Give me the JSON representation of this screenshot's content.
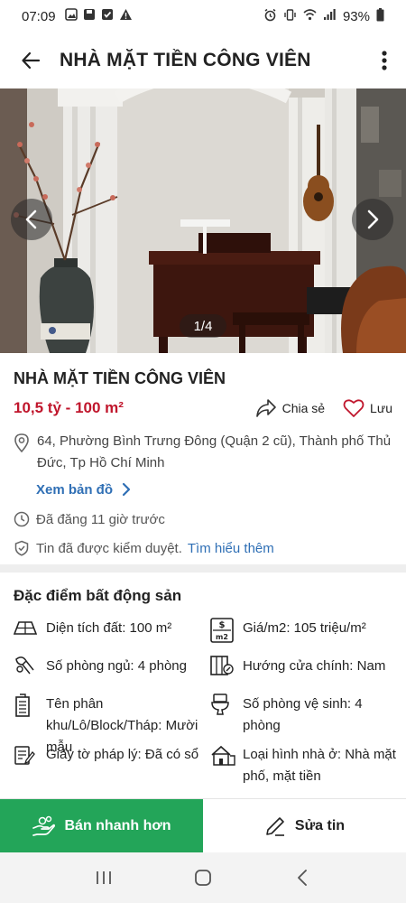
{
  "status_bar": {
    "time": "07:09",
    "battery": "93%",
    "left_icons": [
      "image-icon",
      "save-icon",
      "check-square-icon",
      "warning-icon"
    ],
    "right_icons": [
      "alarm-icon",
      "vibrate-icon",
      "wifi-icon",
      "signal-icon",
      "battery-icon"
    ]
  },
  "app_bar": {
    "title": "NHÀ MẶT TIỀN CÔNG VIÊN"
  },
  "gallery": {
    "counter": "1/4"
  },
  "listing": {
    "title": "NHÀ MẶT TIỀN CÔNG VIÊN",
    "price": "10,5 tỷ",
    "separator": "-",
    "area": "100 m²",
    "share_label": "Chia sẻ",
    "save_label": "Lưu",
    "address": "64, Phường Bình Trưng Đông (Quận 2 cũ), Thành phố Thủ Đức, Tp Hồ Chí Minh",
    "map_link": "Xem bản đồ",
    "posted": "Đã đăng 11 giờ trước",
    "moderated": "Tin đã được kiểm duyệt.",
    "learn_more": "Tìm hiểu thêm"
  },
  "features": {
    "heading": "Đặc điểm bất động sản",
    "items": [
      {
        "icon": "land-area-icon",
        "text": "Diện tích đất: 100 m²"
      },
      {
        "icon": "price-per-m2-icon",
        "text": "Giá/m2: 105 triệu/m²"
      },
      {
        "icon": "bedroom-icon",
        "text": "Số phòng ngủ: 4 phòng"
      },
      {
        "icon": "door-direction-icon",
        "text": "Hướng cửa chính: Nam"
      },
      {
        "icon": "building-block-icon",
        "text": "Tên phân khu/Lô/Block/Tháp: Mười mẫu"
      },
      {
        "icon": "toilet-icon",
        "text": "Số phòng vệ sinh: 4 phòng"
      },
      {
        "icon": "legal-document-icon",
        "text": "Giấy tờ pháp lý: Đã có sổ"
      },
      {
        "icon": "house-type-icon",
        "text": "Loại hình nhà ở: Nhà mặt phố, mặt tiền"
      }
    ]
  },
  "actions": {
    "sell_faster": "Bán nhanh hơn",
    "edit": "Sửa tin"
  },
  "colors": {
    "price_red": "#c0162c",
    "link_blue": "#2f6fb5",
    "sell_green": "#23a559"
  }
}
